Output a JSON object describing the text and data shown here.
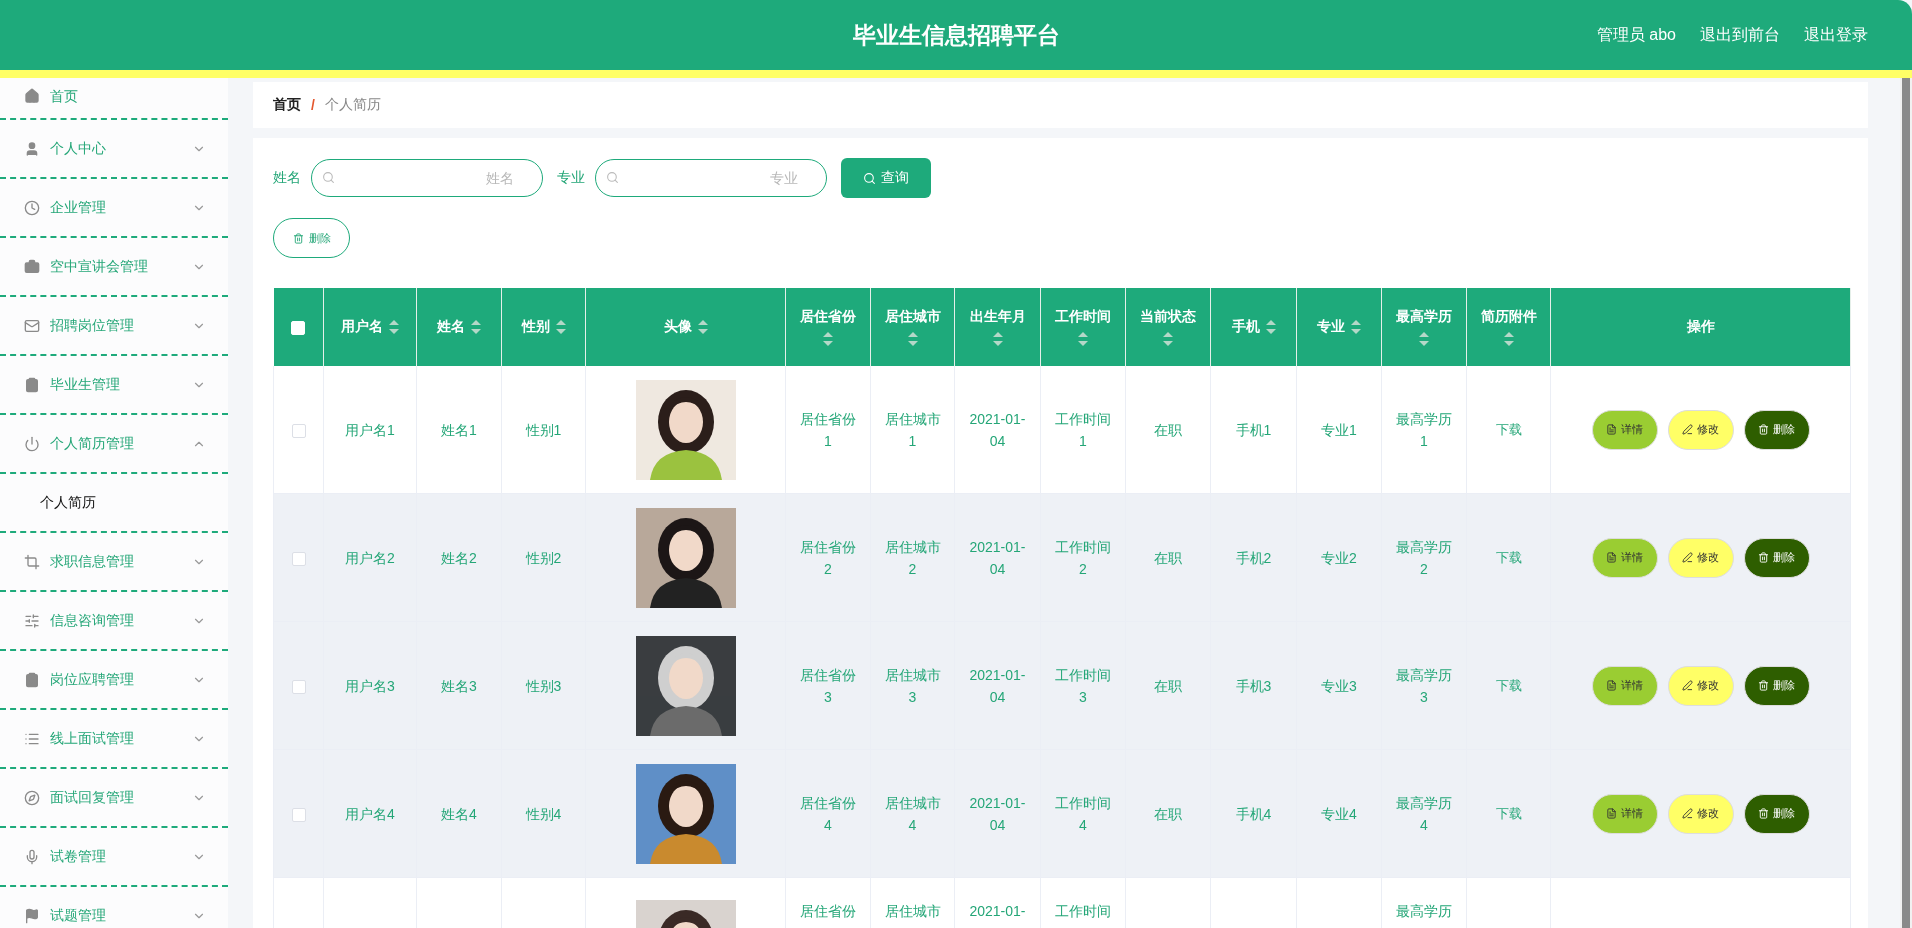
{
  "header": {
    "title": "毕业生信息招聘平台",
    "links": [
      "管理员 abo",
      "退出到前台",
      "退出登录"
    ]
  },
  "sidebar": {
    "items": [
      {
        "label": "首页",
        "kind": "link"
      },
      {
        "label": "个人中心",
        "kind": "menu",
        "expanded": false
      },
      {
        "label": "企业管理",
        "kind": "menu",
        "expanded": false
      },
      {
        "label": "空中宣讲会管理",
        "kind": "menu",
        "expanded": false
      },
      {
        "label": "招聘岗位管理",
        "kind": "menu",
        "expanded": false
      },
      {
        "label": "毕业生管理",
        "kind": "menu",
        "expanded": false
      },
      {
        "label": "个人简历管理",
        "kind": "menu",
        "expanded": true,
        "children": [
          {
            "label": "个人简历",
            "selected": true
          }
        ]
      },
      {
        "label": "求职信息管理",
        "kind": "menu",
        "expanded": false
      },
      {
        "label": "信息咨询管理",
        "kind": "menu",
        "expanded": false
      },
      {
        "label": "岗位应聘管理",
        "kind": "menu",
        "expanded": false
      },
      {
        "label": "线上面试管理",
        "kind": "menu",
        "expanded": false
      },
      {
        "label": "面试回复管理",
        "kind": "menu",
        "expanded": false
      },
      {
        "label": "试卷管理",
        "kind": "menu",
        "expanded": false
      },
      {
        "label": "试题管理",
        "kind": "menu",
        "expanded": false
      }
    ]
  },
  "breadcrumb": {
    "items": [
      "首页",
      "个人简历"
    ],
    "separator": "/"
  },
  "search": {
    "fields": [
      {
        "label": "姓名",
        "placeholder": "姓名"
      },
      {
        "label": "专业",
        "placeholder": "专业"
      }
    ],
    "button": "查询"
  },
  "toolbar": {
    "delete_button": "删除"
  },
  "table": {
    "select_all": {
      "checked": false
    },
    "columns": [
      {
        "label": "用户名",
        "sortable": true,
        "wrap": false
      },
      {
        "label": "姓名",
        "sortable": true,
        "wrap": false
      },
      {
        "label": "性别",
        "sortable": true,
        "wrap": false
      },
      {
        "label": "头像",
        "sortable": true,
        "wrap": false
      },
      {
        "label": "居住省份",
        "sortable": true,
        "wrap": true
      },
      {
        "label": "居住城市",
        "sortable": true,
        "wrap": true
      },
      {
        "label": "出生年月",
        "sortable": true,
        "wrap": true
      },
      {
        "label": "工作时间",
        "sortable": true,
        "wrap": true
      },
      {
        "label": "当前状态",
        "sortable": true,
        "wrap": true
      },
      {
        "label": "手机",
        "sortable": true,
        "wrap": false
      },
      {
        "label": "专业",
        "sortable": true,
        "wrap": false
      },
      {
        "label": "最高学历",
        "sortable": true,
        "wrap": true
      },
      {
        "label": "简历附件",
        "sortable": true,
        "wrap": true
      },
      {
        "label": "操作",
        "sortable": false
      }
    ],
    "rows": [
      {
        "kind": "full",
        "shaded": false,
        "checked": false,
        "cells": [
          "用户名1",
          "姓名1",
          "性别1",
          {
            "kind": "picture"
          },
          "居住省份1",
          "居住城市1",
          "2021-01-04",
          "工作时间1",
          "在职",
          "手机1",
          "专业1",
          "最高学历1",
          {
            "kind": "link",
            "text": "下载"
          },
          {
            "kind": "actions",
            "buttons": [
              "详情",
              "修改",
              "删除"
            ]
          }
        ]
      },
      {
        "kind": "full",
        "shaded": true,
        "checked": false,
        "cells": [
          "用户名2",
          "姓名2",
          "性别2",
          {
            "kind": "picture"
          },
          "居住省份2",
          "居住城市2",
          "2021-01-04",
          "工作时间2",
          "在职",
          "手机2",
          "专业2",
          "最高学历2",
          {
            "kind": "link",
            "text": "下载"
          },
          {
            "kind": "actions",
            "buttons": [
              "详情",
              "修改",
              "删除"
            ]
          }
        ]
      },
      {
        "kind": "full",
        "shaded": true,
        "checked": false,
        "cells": [
          "用户名3",
          "姓名3",
          "性别3",
          {
            "kind": "picture"
          },
          "居住省份3",
          "居住城市3",
          "2021-01-04",
          "工作时间3",
          "在职",
          "手机3",
          "专业3",
          "最高学历3",
          {
            "kind": "link",
            "text": "下载"
          },
          {
            "kind": "actions",
            "buttons": [
              "详情",
              "修改",
              "删除"
            ]
          }
        ]
      },
      {
        "kind": "full",
        "shaded": true,
        "checked": false,
        "cells": [
          "用户名4",
          "姓名4",
          "性别4",
          {
            "kind": "picture"
          },
          "居住省份4",
          "居住城市4",
          "2021-01-04",
          "工作时间4",
          "在职",
          "手机4",
          "专业4",
          "最高学历4",
          {
            "kind": "link",
            "text": "下载"
          },
          {
            "kind": "actions",
            "buttons": [
              "详情",
              "修改",
              "删除"
            ]
          }
        ]
      },
      {
        "kind": "partial",
        "shaded": false,
        "cells": [
          null,
          null,
          null,
          {
            "kind": "picture"
          },
          "居住省份",
          "居住城市",
          "2021-01-",
          "工作时间",
          null,
          null,
          null,
          "最高学历",
          null,
          null
        ]
      }
    ]
  }
}
